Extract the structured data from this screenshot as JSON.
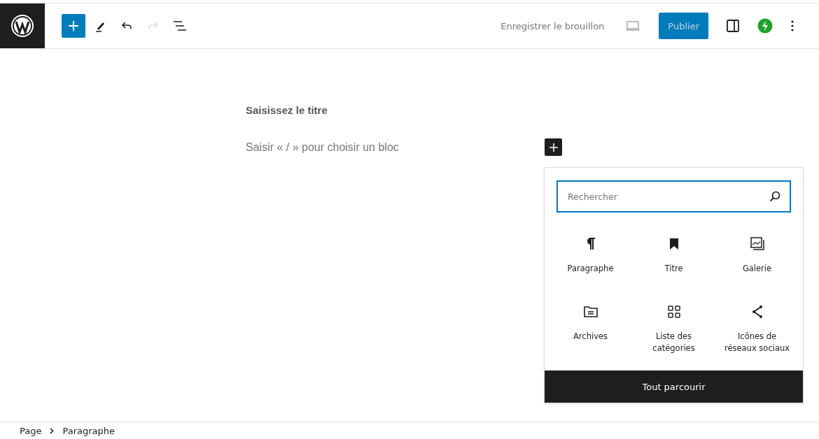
{
  "toolbar": {
    "left_tools": [
      {
        "kind": "add",
        "selected": true,
        "disabled": false
      },
      {
        "kind": "pen",
        "selected": false,
        "disabled": false
      },
      {
        "kind": "undo",
        "selected": false,
        "disabled": false
      },
      {
        "kind": "redo",
        "selected": false,
        "disabled": true
      },
      {
        "kind": "outline",
        "selected": false,
        "disabled": false
      }
    ],
    "save_draft": "Enregistrer le brouillon",
    "publish": "Publier"
  },
  "editor": {
    "title_placeholder": "Saisissez le titre",
    "block_placeholder": "Saisir « / » pour choisir un bloc"
  },
  "inserter": {
    "search": {
      "placeholder": "Rechercher"
    },
    "blocks": [
      {
        "label": "Paragraphe",
        "kind": "paragraph"
      },
      {
        "label": "Titre",
        "kind": "heading"
      },
      {
        "label": "Galerie",
        "kind": "gallery"
      },
      {
        "label": "Archives",
        "kind": "archives"
      },
      {
        "label": "Liste des catégories",
        "kind": "categories"
      },
      {
        "label": "Icônes de réseaux sociaux",
        "kind": "social"
      }
    ],
    "browse_all": "Tout parcourir"
  },
  "breadcrumb": [
    "Page",
    "Paragraphe"
  ]
}
